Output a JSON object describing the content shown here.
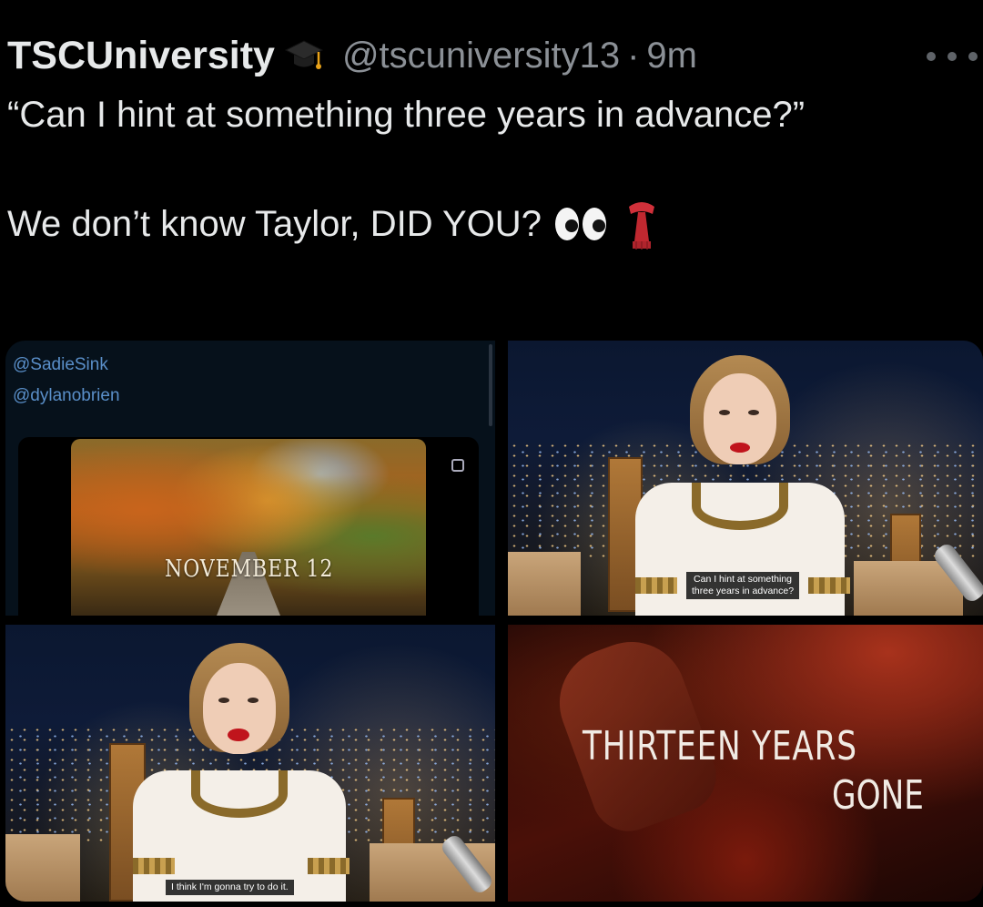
{
  "tweet": {
    "display_name": "TSCUniversity",
    "badge_icon": "graduation-cap-icon",
    "handle": "@tscuniversity13",
    "separator": "·",
    "time": "9m",
    "text_line1": "“Can I hint at something three years in advance?”",
    "text_line2": "We don’t know Taylor, DID YOU?",
    "emojis": [
      "eyes-icon",
      "scarf-icon"
    ]
  },
  "media": {
    "panel1": {
      "mentions": [
        "@SadieSink",
        "@dylanobrien"
      ],
      "overlay_text": "NOVEMBER 12"
    },
    "panel2": {
      "caption_line1": "Can I hint at something",
      "caption_line2": "three years in advance?"
    },
    "panel3": {
      "caption": "I think I'm gonna try to do it."
    },
    "panel4": {
      "title_line1": "THIRTEEN  YEARS",
      "title_line2": "GONE"
    }
  },
  "colors": {
    "background": "#000000",
    "text": "#e7e9ea",
    "secondary": "#8b9096",
    "mention": "#5a8fc9"
  }
}
